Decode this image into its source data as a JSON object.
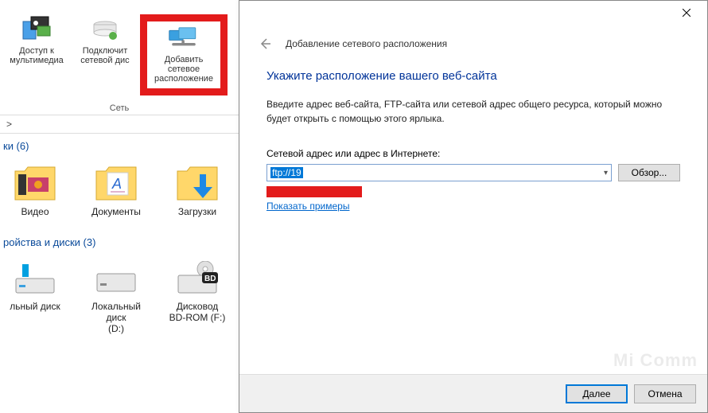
{
  "ribbon": {
    "items": [
      {
        "label_line1": "Доступ к",
        "label_line2": "мультимедиа"
      },
      {
        "label_line1": "Подключит",
        "label_line2": "сетевой дис"
      },
      {
        "label_line1": "Добавить сетевое",
        "label_line2": "расположение"
      }
    ],
    "group_label": "Сеть"
  },
  "breadcrumb": ">",
  "explorer": {
    "section1": {
      "header": "ки (6)",
      "items": [
        "Видео",
        "Документы",
        "Загрузки"
      ]
    },
    "section2": {
      "header": "ройства и диски (3)",
      "items": [
        {
          "line1": "льный диск"
        },
        {
          "line1": "Локальный диск",
          "line2": "(D:)"
        },
        {
          "line1": "Дисковод",
          "line2": "BD-ROM (F:)"
        }
      ],
      "bd_badge": "BD"
    }
  },
  "dialog": {
    "header_title": "Добавление сетевого расположения",
    "heading": "Укажите расположение вашего веб-сайта",
    "description": "Введите адрес веб-сайта, FTP-сайта или сетевой адрес общего ресурса, который можно будет открыть с помощью этого ярлыка.",
    "field_label": "Сетевой адрес или адрес в Интернете:",
    "field_value": "ftp://19",
    "browse_label": "Обзор...",
    "examples_link": "Показать примеры",
    "next_label": "Далее",
    "cancel_label": "Отмена"
  },
  "watermark": "Mi Comm"
}
